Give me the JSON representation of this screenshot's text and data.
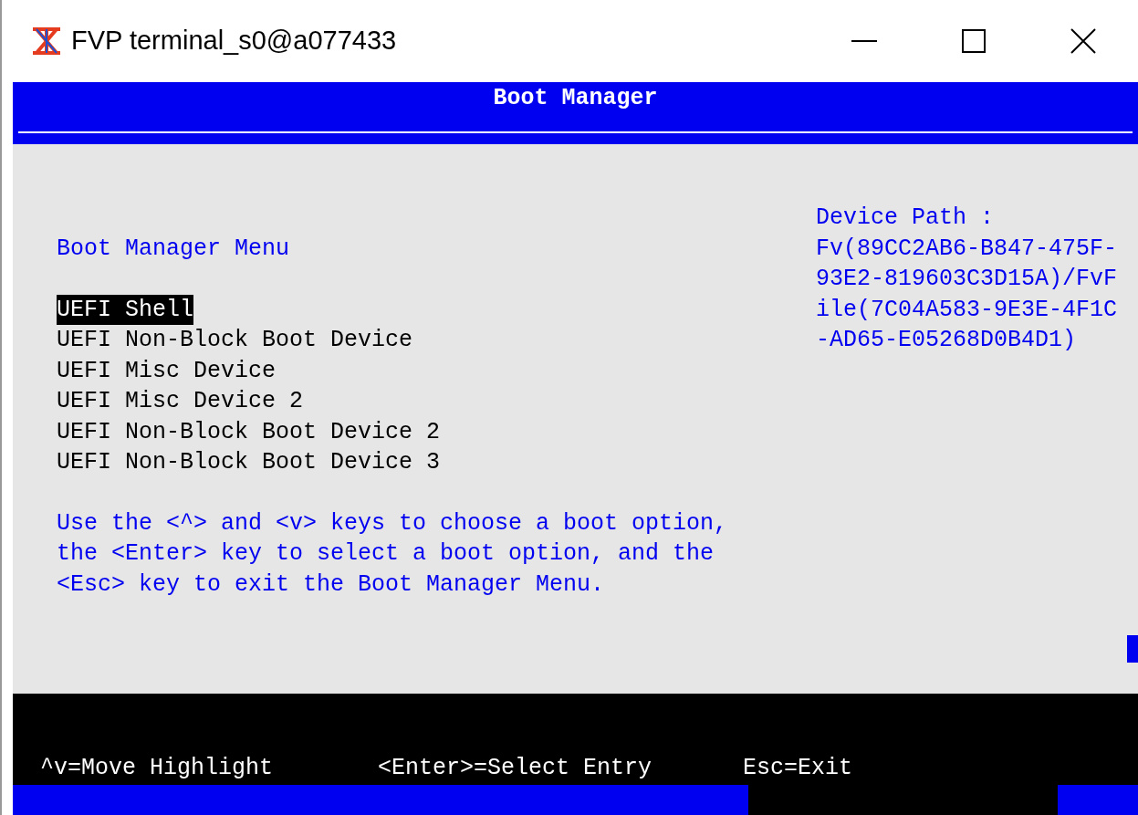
{
  "window": {
    "title": "FVP terminal_s0@a077433"
  },
  "header": {
    "title": "Boot Manager"
  },
  "menu": {
    "title": "Boot Manager Menu",
    "items": [
      {
        "label": "UEFI Shell",
        "selected": true
      },
      {
        "label": "UEFI Non-Block Boot Device",
        "selected": false
      },
      {
        "label": "UEFI Misc Device",
        "selected": false
      },
      {
        "label": "UEFI Misc Device 2",
        "selected": false
      },
      {
        "label": "UEFI Non-Block Boot Device 2",
        "selected": false
      },
      {
        "label": "UEFI Non-Block Boot Device 3",
        "selected": false
      }
    ]
  },
  "help_lines": [
    "Use the <^> and <v> keys to choose a boot option,",
    "the <Enter> key to select a boot option, and the",
    "<Esc> key to exit the Boot Manager Menu."
  ],
  "device_path": {
    "label": "Device Path :",
    "lines": [
      "Fv(89CC2AB6-B847-475F-",
      "93E2-819603C3D15A)/FvF",
      "ile(7C04A583-9E3E-4F1C",
      "-AD65-E05268D0B4D1)"
    ]
  },
  "footer_hints": [
    "^v=Move Highlight",
    "<Enter>=Select Entry",
    "Esc=Exit"
  ]
}
